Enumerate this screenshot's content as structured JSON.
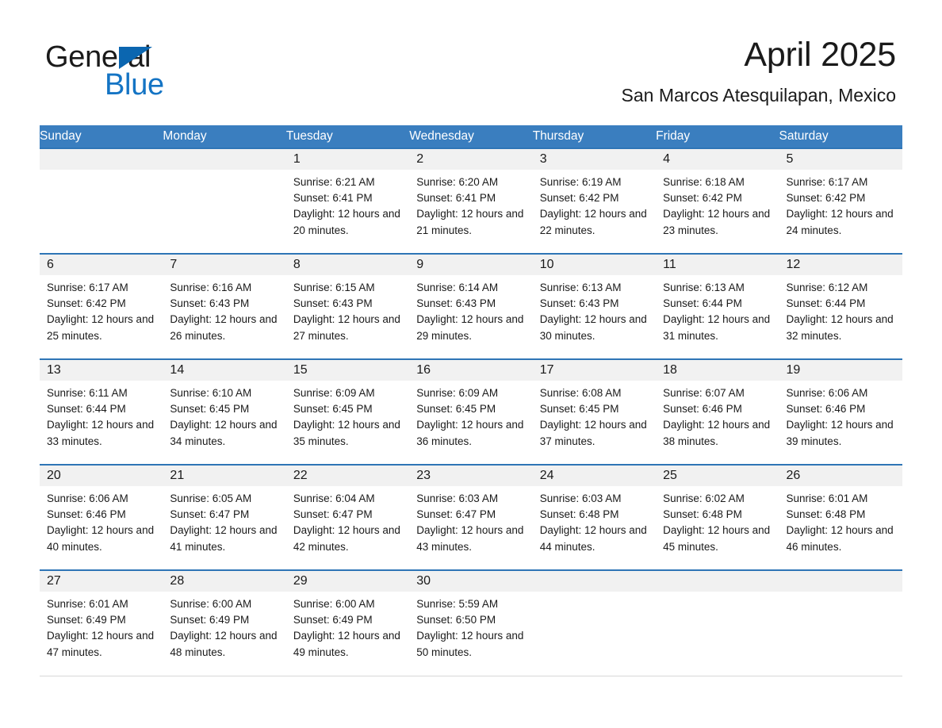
{
  "logo": {
    "word_one": "General",
    "word_two": "Blue",
    "triangle_color": "#0b66b0",
    "blue_text_color": "#1474c4"
  },
  "header": {
    "title": "April 2025",
    "subtitle": "San Marcos Atesquilapan, Mexico"
  },
  "theme": {
    "header_blue": "#3a7ebf",
    "row_divider_blue": "#2e75b6",
    "daynum_band": "#f1f1f1",
    "page_background": "#ffffff"
  },
  "weekday_headers": [
    "Sunday",
    "Monday",
    "Tuesday",
    "Wednesday",
    "Thursday",
    "Friday",
    "Saturday"
  ],
  "labels": {
    "sunrise_prefix": "Sunrise:",
    "sunset_prefix": "Sunset:",
    "daylight_prefix": "Daylight:"
  },
  "weeks": [
    [
      {
        "day": "",
        "empty": true
      },
      {
        "day": "",
        "empty": true
      },
      {
        "day": "1",
        "sunrise": "Sunrise: 6:21 AM",
        "sunset": "Sunset: 6:41 PM",
        "daylight": "Daylight: 12 hours and 20 minutes."
      },
      {
        "day": "2",
        "sunrise": "Sunrise: 6:20 AM",
        "sunset": "Sunset: 6:41 PM",
        "daylight": "Daylight: 12 hours and 21 minutes."
      },
      {
        "day": "3",
        "sunrise": "Sunrise: 6:19 AM",
        "sunset": "Sunset: 6:42 PM",
        "daylight": "Daylight: 12 hours and 22 minutes."
      },
      {
        "day": "4",
        "sunrise": "Sunrise: 6:18 AM",
        "sunset": "Sunset: 6:42 PM",
        "daylight": "Daylight: 12 hours and 23 minutes."
      },
      {
        "day": "5",
        "sunrise": "Sunrise: 6:17 AM",
        "sunset": "Sunset: 6:42 PM",
        "daylight": "Daylight: 12 hours and 24 minutes."
      }
    ],
    [
      {
        "day": "6",
        "sunrise": "Sunrise: 6:17 AM",
        "sunset": "Sunset: 6:42 PM",
        "daylight": "Daylight: 12 hours and 25 minutes."
      },
      {
        "day": "7",
        "sunrise": "Sunrise: 6:16 AM",
        "sunset": "Sunset: 6:43 PM",
        "daylight": "Daylight: 12 hours and 26 minutes."
      },
      {
        "day": "8",
        "sunrise": "Sunrise: 6:15 AM",
        "sunset": "Sunset: 6:43 PM",
        "daylight": "Daylight: 12 hours and 27 minutes."
      },
      {
        "day": "9",
        "sunrise": "Sunrise: 6:14 AM",
        "sunset": "Sunset: 6:43 PM",
        "daylight": "Daylight: 12 hours and 29 minutes."
      },
      {
        "day": "10",
        "sunrise": "Sunrise: 6:13 AM",
        "sunset": "Sunset: 6:43 PM",
        "daylight": "Daylight: 12 hours and 30 minutes."
      },
      {
        "day": "11",
        "sunrise": "Sunrise: 6:13 AM",
        "sunset": "Sunset: 6:44 PM",
        "daylight": "Daylight: 12 hours and 31 minutes."
      },
      {
        "day": "12",
        "sunrise": "Sunrise: 6:12 AM",
        "sunset": "Sunset: 6:44 PM",
        "daylight": "Daylight: 12 hours and 32 minutes."
      }
    ],
    [
      {
        "day": "13",
        "sunrise": "Sunrise: 6:11 AM",
        "sunset": "Sunset: 6:44 PM",
        "daylight": "Daylight: 12 hours and 33 minutes."
      },
      {
        "day": "14",
        "sunrise": "Sunrise: 6:10 AM",
        "sunset": "Sunset: 6:45 PM",
        "daylight": "Daylight: 12 hours and 34 minutes."
      },
      {
        "day": "15",
        "sunrise": "Sunrise: 6:09 AM",
        "sunset": "Sunset: 6:45 PM",
        "daylight": "Daylight: 12 hours and 35 minutes."
      },
      {
        "day": "16",
        "sunrise": "Sunrise: 6:09 AM",
        "sunset": "Sunset: 6:45 PM",
        "daylight": "Daylight: 12 hours and 36 minutes."
      },
      {
        "day": "17",
        "sunrise": "Sunrise: 6:08 AM",
        "sunset": "Sunset: 6:45 PM",
        "daylight": "Daylight: 12 hours and 37 minutes."
      },
      {
        "day": "18",
        "sunrise": "Sunrise: 6:07 AM",
        "sunset": "Sunset: 6:46 PM",
        "daylight": "Daylight: 12 hours and 38 minutes."
      },
      {
        "day": "19",
        "sunrise": "Sunrise: 6:06 AM",
        "sunset": "Sunset: 6:46 PM",
        "daylight": "Daylight: 12 hours and 39 minutes."
      }
    ],
    [
      {
        "day": "20",
        "sunrise": "Sunrise: 6:06 AM",
        "sunset": "Sunset: 6:46 PM",
        "daylight": "Daylight: 12 hours and 40 minutes."
      },
      {
        "day": "21",
        "sunrise": "Sunrise: 6:05 AM",
        "sunset": "Sunset: 6:47 PM",
        "daylight": "Daylight: 12 hours and 41 minutes."
      },
      {
        "day": "22",
        "sunrise": "Sunrise: 6:04 AM",
        "sunset": "Sunset: 6:47 PM",
        "daylight": "Daylight: 12 hours and 42 minutes."
      },
      {
        "day": "23",
        "sunrise": "Sunrise: 6:03 AM",
        "sunset": "Sunset: 6:47 PM",
        "daylight": "Daylight: 12 hours and 43 minutes."
      },
      {
        "day": "24",
        "sunrise": "Sunrise: 6:03 AM",
        "sunset": "Sunset: 6:48 PM",
        "daylight": "Daylight: 12 hours and 44 minutes."
      },
      {
        "day": "25",
        "sunrise": "Sunrise: 6:02 AM",
        "sunset": "Sunset: 6:48 PM",
        "daylight": "Daylight: 12 hours and 45 minutes."
      },
      {
        "day": "26",
        "sunrise": "Sunrise: 6:01 AM",
        "sunset": "Sunset: 6:48 PM",
        "daylight": "Daylight: 12 hours and 46 minutes."
      }
    ],
    [
      {
        "day": "27",
        "sunrise": "Sunrise: 6:01 AM",
        "sunset": "Sunset: 6:49 PM",
        "daylight": "Daylight: 12 hours and 47 minutes."
      },
      {
        "day": "28",
        "sunrise": "Sunrise: 6:00 AM",
        "sunset": "Sunset: 6:49 PM",
        "daylight": "Daylight: 12 hours and 48 minutes."
      },
      {
        "day": "29",
        "sunrise": "Sunrise: 6:00 AM",
        "sunset": "Sunset: 6:49 PM",
        "daylight": "Daylight: 12 hours and 49 minutes."
      },
      {
        "day": "30",
        "sunrise": "Sunrise: 5:59 AM",
        "sunset": "Sunset: 6:50 PM",
        "daylight": "Daylight: 12 hours and 50 minutes."
      },
      {
        "day": "",
        "empty": true
      },
      {
        "day": "",
        "empty": true
      },
      {
        "day": "",
        "empty": true
      }
    ]
  ]
}
